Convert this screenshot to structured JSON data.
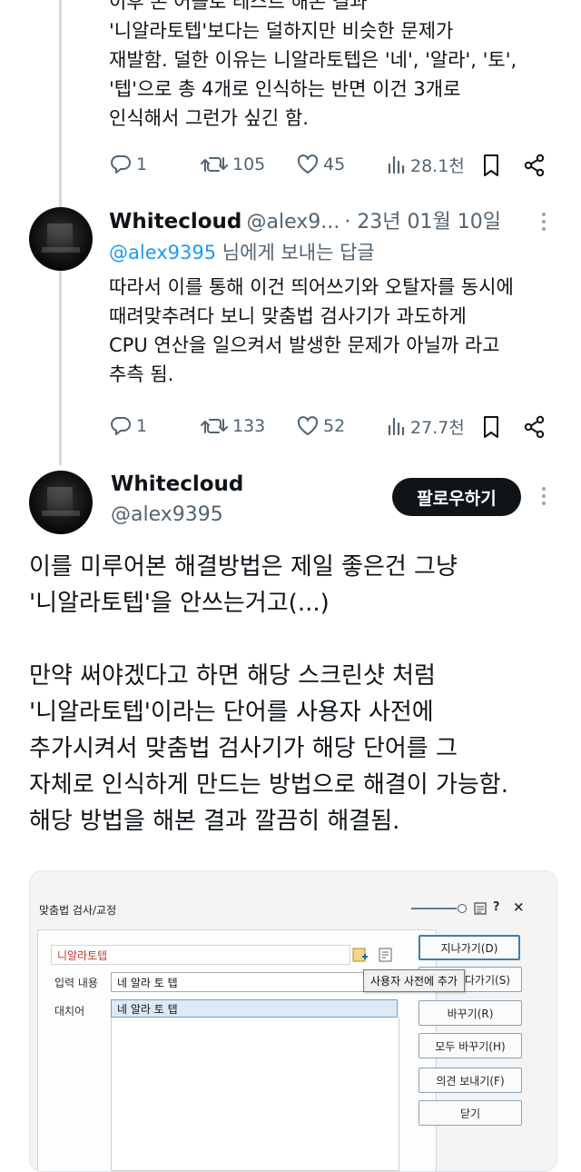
{
  "tweet1": {
    "lines": [
      "이후 본 어플로 테스트 해본 결과",
      "'니알라토텝'보다는 덜하지만 비슷한 문제가",
      "재발함. 덜한 이유는 니알라토텝은 '네', '알라', '토',",
      "'텝'으로 총 4개로 인식하는 반면 이건 3개로",
      "인식해서 그런가 싶긴 함."
    ],
    "stats": {
      "replies": "1",
      "reposts": "105",
      "likes": "45",
      "views": "28.1천"
    }
  },
  "tweet2": {
    "name": "Whitecloud",
    "handle": "@alex9...",
    "date": "· 23년 01월 10일",
    "reply_to_mention": "@alex9395",
    "reply_to_suffix": " 님에게 보내는 답글",
    "lines": [
      "따라서 이를 통해 이건 띄어쓰기와 오탈자를 동시에",
      "때려맞추려다 보니 맞춤법 검사기가 과도하게",
      "CPU 연산을 일으켜서 발생한 문제가 아닐까 라고",
      "추측 됨."
    ],
    "stats": {
      "replies": "1",
      "reposts": "133",
      "likes": "52",
      "views": "27.7천"
    }
  },
  "main_tweet": {
    "name": "Whitecloud",
    "handle": "@alex9395",
    "follow_label": "팔로우하기",
    "lines": [
      "이를 미루어본 해결방법은 제일 좋은건 그냥",
      "'니알라토텝'을 안쓰는거고(...)",
      "",
      "만약 써야겠다고 하면 해당 스크린샷 처럼",
      "'니알라토텝'이라는 단어를 사용자 사전에",
      "추가시켜서 맞춤법 검사기가 해당 단어를 그",
      "자체로 인식하게 만드는 방법으로 해결이 가능함.",
      "해당 방법을 해본 결과 깔끔히 해결됨."
    ]
  },
  "dialog": {
    "title": "맞춤법 검사/교정",
    "title_controls": {
      "help": "?",
      "close": "×"
    },
    "error_word": "니알라토텝",
    "input_label": "입력 내용",
    "input_value": "네 알라 토 텝",
    "replace_label": "대치어",
    "replace_value": "네 알라 토 텝",
    "tooltip": "사용자 사전에 추가",
    "buttons": [
      "지나가기(D)",
      "다가기(S)",
      "바꾸기(R)",
      "모두 바꾸기(H)",
      "의견 보내기(F)",
      "닫기"
    ]
  },
  "colors": {
    "accent": "#1d9bf0",
    "muted": "#536471",
    "text": "#0f1419",
    "error_word": "#c0392b"
  }
}
